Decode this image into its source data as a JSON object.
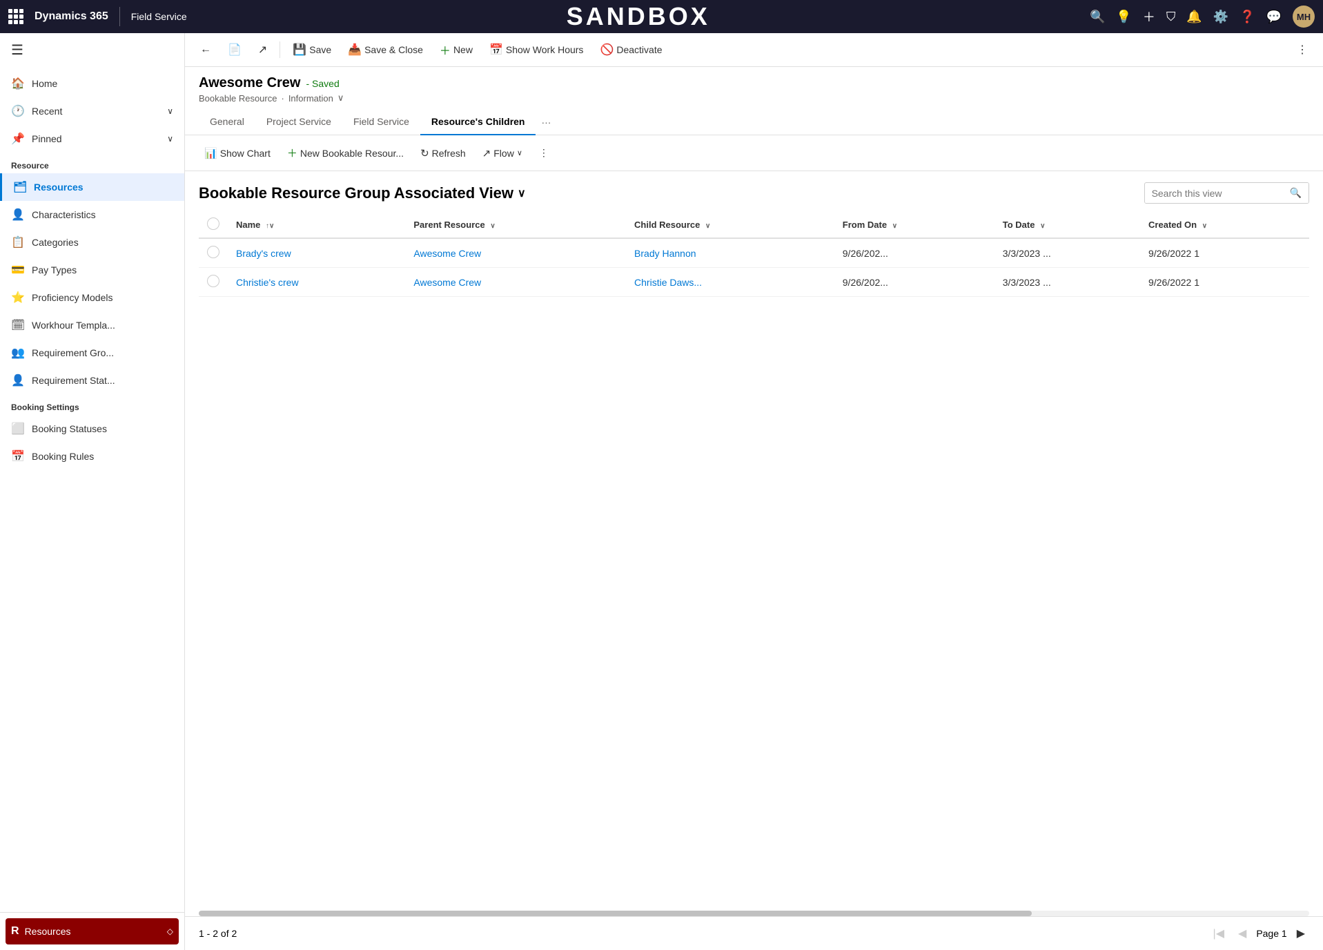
{
  "topnav": {
    "brand": "Dynamics 365",
    "module": "Field Service",
    "sandbox_title": "SANDBOX",
    "avatar_initials": "MH"
  },
  "sidebar": {
    "nav_items": [
      {
        "id": "home",
        "label": "Home",
        "icon": "🏠"
      },
      {
        "id": "recent",
        "label": "Recent",
        "icon": "🕐",
        "has_chevron": true
      },
      {
        "id": "pinned",
        "label": "Pinned",
        "icon": "📌",
        "has_chevron": true
      }
    ],
    "resource_section_title": "Resource",
    "resource_items": [
      {
        "id": "resources",
        "label": "Resources",
        "icon": "🗂",
        "active": true
      },
      {
        "id": "characteristics",
        "label": "Characteristics",
        "icon": "👤"
      },
      {
        "id": "categories",
        "label": "Categories",
        "icon": "📋"
      },
      {
        "id": "pay-types",
        "label": "Pay Types",
        "icon": "💳"
      },
      {
        "id": "proficiency-models",
        "label": "Proficiency Models",
        "icon": "⭐"
      },
      {
        "id": "workhour-templates",
        "label": "Workhour Templa...",
        "icon": "🗓"
      },
      {
        "id": "requirement-groups",
        "label": "Requirement Gro...",
        "icon": "👥"
      },
      {
        "id": "requirement-statuses",
        "label": "Requirement Stat...",
        "icon": "👤"
      }
    ],
    "booking_section_title": "Booking Settings",
    "booking_items": [
      {
        "id": "booking-statuses",
        "label": "Booking Statuses",
        "icon": "⬜"
      },
      {
        "id": "booking-rules",
        "label": "Booking Rules",
        "icon": "📅"
      }
    ],
    "bottom_item": {
      "label": "Resources",
      "icon": "R"
    }
  },
  "command_bar": {
    "back_label": "←",
    "form_icon": "📄",
    "open_icon": "↗",
    "save_label": "Save",
    "save_close_label": "Save & Close",
    "new_label": "New",
    "show_work_hours_label": "Show Work Hours",
    "deactivate_label": "Deactivate",
    "more_label": "⋮"
  },
  "record": {
    "title": "Awesome Crew",
    "saved_label": "- Saved",
    "entity_type": "Bookable Resource",
    "form_type": "Information"
  },
  "tabs": [
    {
      "id": "general",
      "label": "General",
      "active": false
    },
    {
      "id": "project-service",
      "label": "Project Service",
      "active": false
    },
    {
      "id": "field-service",
      "label": "Field Service",
      "active": false
    },
    {
      "id": "resources-children",
      "label": "Resource's Children",
      "active": true
    }
  ],
  "sub_toolbar": {
    "show_chart_label": "Show Chart",
    "new_bookable_resource_label": "New Bookable Resour...",
    "refresh_label": "Refresh",
    "flow_label": "Flow",
    "more_label": "⋮"
  },
  "view": {
    "title": "Bookable Resource Group Associated View",
    "search_placeholder": "Search this view"
  },
  "table": {
    "columns": [
      {
        "id": "name",
        "label": "Name",
        "sortable": true
      },
      {
        "id": "parent-resource",
        "label": "Parent Resource",
        "sortable": true
      },
      {
        "id": "child-resource",
        "label": "Child Resource",
        "sortable": true
      },
      {
        "id": "from-date",
        "label": "From Date",
        "sortable": true
      },
      {
        "id": "to-date",
        "label": "To Date",
        "sortable": true
      },
      {
        "id": "created-on",
        "label": "Created On",
        "sortable": true
      }
    ],
    "rows": [
      {
        "name": "Brady's crew",
        "parent_resource": "Awesome Crew",
        "child_resource": "Brady Hannon",
        "from_date": "9/26/202...",
        "to_date": "3/3/2023 ...",
        "created_on": "9/26/2022 1"
      },
      {
        "name": "Christie's crew",
        "parent_resource": "Awesome Crew",
        "child_resource": "Christie Daws...",
        "from_date": "9/26/202...",
        "to_date": "3/3/2023 ...",
        "created_on": "9/26/2022 1"
      }
    ]
  },
  "footer": {
    "record_count": "1 - 2 of 2",
    "page_label": "Page 1"
  }
}
